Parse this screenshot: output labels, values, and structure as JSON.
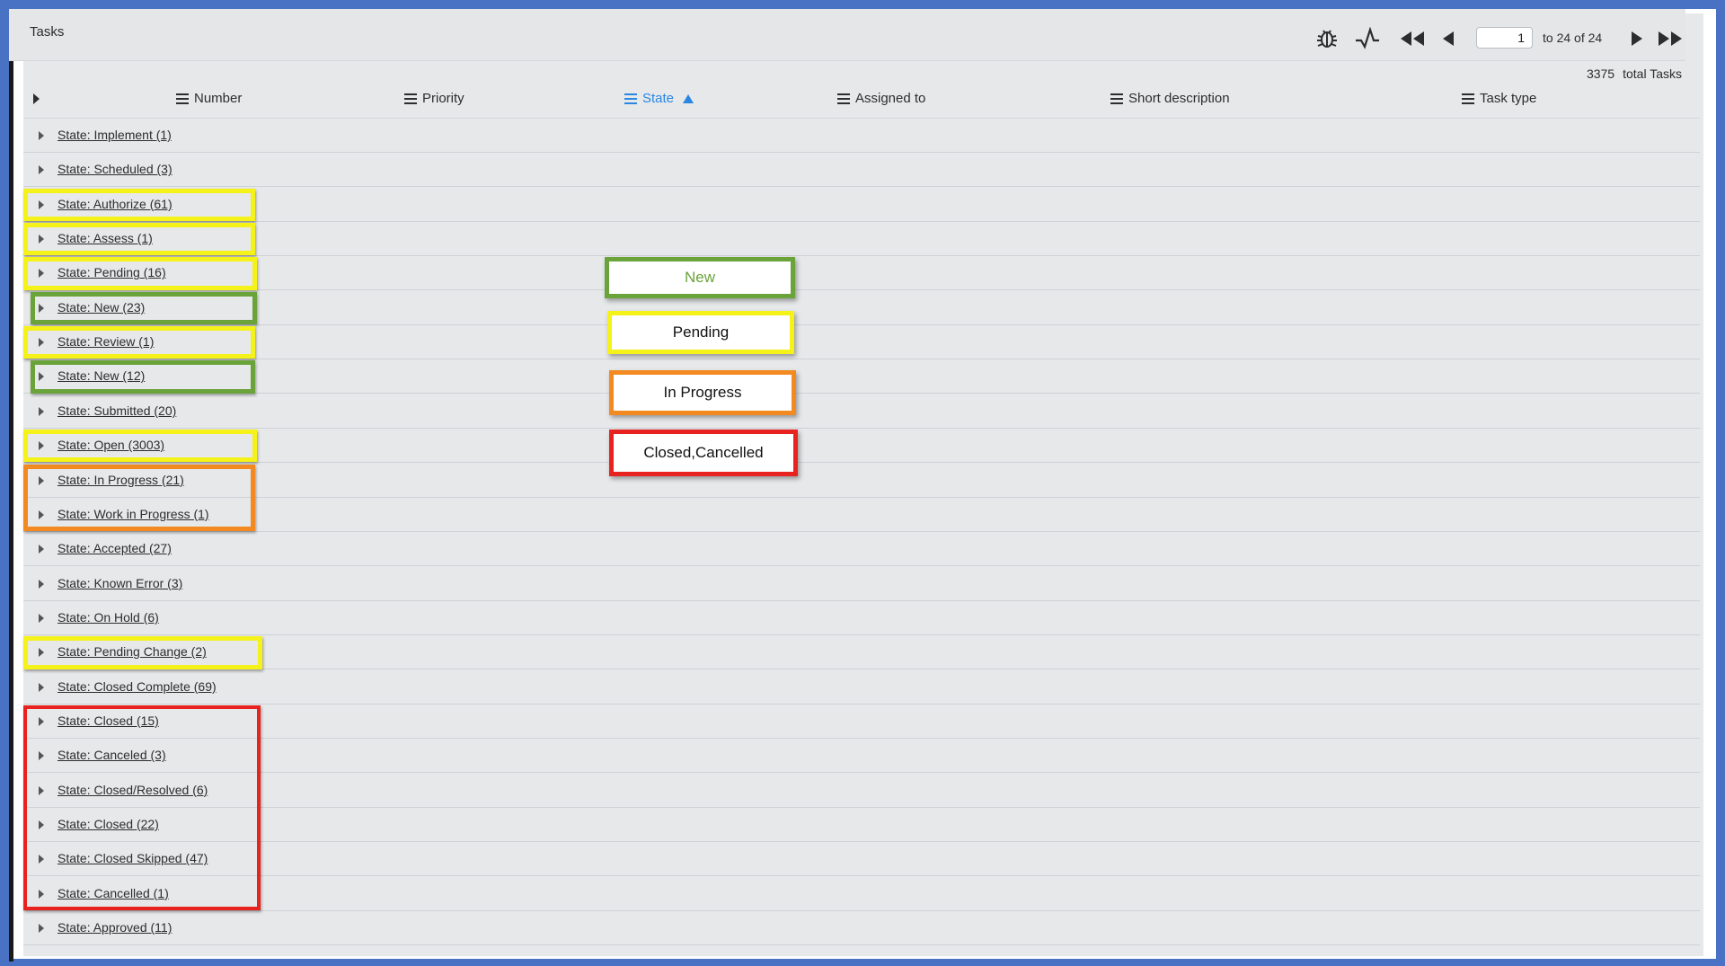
{
  "title": "Tasks",
  "pagination": {
    "page": "1",
    "range": "to 24 of 24"
  },
  "total": {
    "count": "3375",
    "label": "total Tasks"
  },
  "columns": [
    {
      "label": "Number"
    },
    {
      "label": "Priority"
    },
    {
      "label": "State"
    },
    {
      "label": "Assigned to"
    },
    {
      "label": "Short description"
    },
    {
      "label": "Task type"
    }
  ],
  "groups": [
    "State: Implement (1)",
    "State: Scheduled (3)",
    "State: Authorize (61)",
    "State: Assess (1)",
    "State: Pending (16)",
    "State: New (23)",
    "State: Review (1)",
    "State: New (12)",
    "State: Submitted (20)",
    "State: Open (3003)",
    "State: In Progress (21)",
    "State: Work in Progress (1)",
    "State: Accepted (27)",
    "State: Known Error (3)",
    "State: On Hold (6)",
    "State: Pending Change (2)",
    "State: Closed Complete (69)",
    "State: Closed (15)",
    "State: Canceled (3)",
    "State: Closed/Resolved (6)",
    "State: Closed (22)",
    "State: Closed Skipped (47)",
    "State: Cancelled (1)",
    "State: Approved (11)"
  ],
  "legend": {
    "new": "New",
    "pending": "Pending",
    "in_progress": "In Progress",
    "closed": "Closed,Cancelled"
  },
  "colors": {
    "new": "#6aa33a",
    "pending": "#f5f21a",
    "in_progress": "#f28a21",
    "closed": "#e8231f",
    "sort_active": "#2a86e3",
    "frame": "#4a72c4"
  },
  "icons": [
    "debug-icon",
    "activity-icon",
    "first-page-icon",
    "previous-page-icon",
    "next-page-icon",
    "last-page-icon"
  ]
}
